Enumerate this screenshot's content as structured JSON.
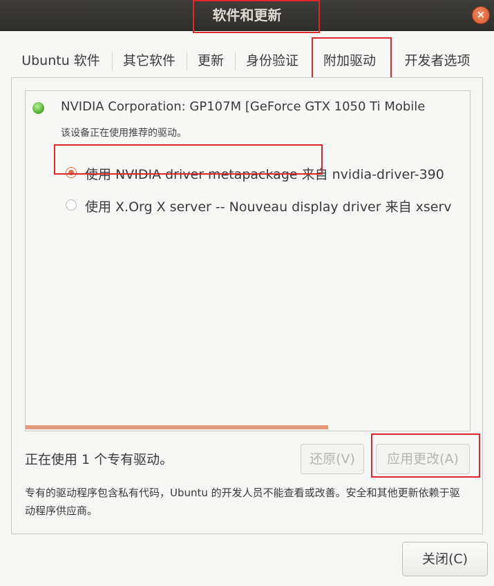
{
  "window": {
    "title": "软件和更新",
    "close_symbol": "×"
  },
  "tabs": [
    {
      "label": "Ubuntu 软件"
    },
    {
      "label": "其它软件"
    },
    {
      "label": "更新"
    },
    {
      "label": "身份验证"
    },
    {
      "label": "附加驱动",
      "active": true
    },
    {
      "label": "开发者选项"
    }
  ],
  "driver": {
    "device_name": "NVIDIA Corporation: GP107M [GeForce GTX 1050 Ti Mobile",
    "device_status": "该设备正在使用推荐的驱动。",
    "options": [
      {
        "label": "使用 NVIDIA driver metapackage 来自 nvidia-driver-390",
        "selected": true
      },
      {
        "label": "使用 X.Org X server -- Nouveau display driver 来自 xserv",
        "selected": false
      }
    ]
  },
  "footer": {
    "status": "正在使用 1 个专有驱动。",
    "revert_label": "还原(V)",
    "apply_label": "应用更改(A)",
    "note": "专有的驱动程序包含私有代码，Ubuntu 的开发人员不能查看或改善。安全和其他更新依赖于驱动程序供应商。"
  },
  "close_button_label": "关闭(C)",
  "colors": {
    "accent": "#e36a3c",
    "highlight": "#e0262b",
    "titlebar": "#33322f"
  },
  "icons": {
    "device_status": "green-led-icon",
    "window_close": "close-icon"
  }
}
